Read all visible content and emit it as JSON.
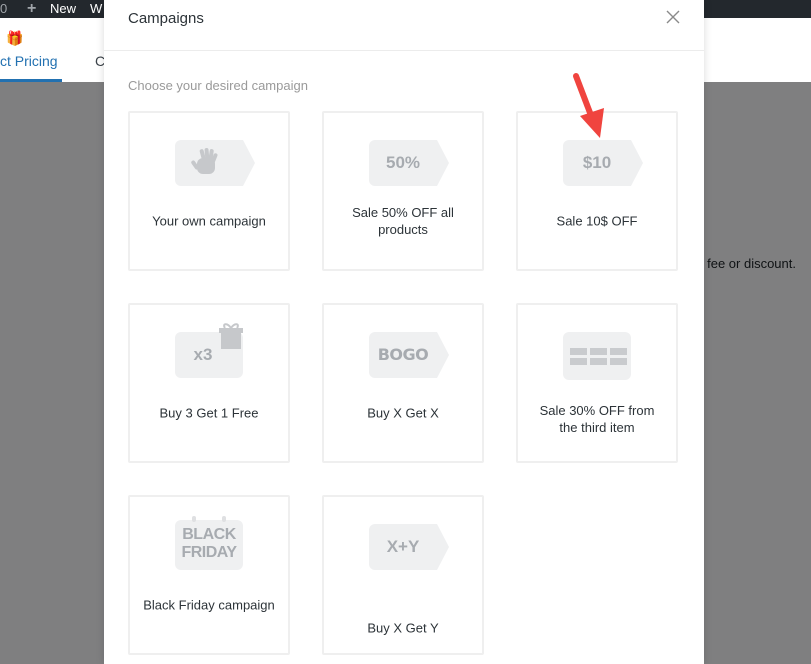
{
  "background": {
    "adminbar": {
      "counter": "0",
      "new_label": "New",
      "trailing": "W"
    },
    "tabs": [
      {
        "label": "ct Pricing",
        "icon": "gift-icon",
        "active": true
      },
      {
        "label": "C",
        "active": false
      }
    ],
    "body_text": "fee or discount.",
    "accent_color": "#2271b1"
  },
  "modal": {
    "title": "Campaigns",
    "close_icon": "close-icon",
    "subtitle": "Choose your desired campaign",
    "campaigns": [
      {
        "label": "Your own campaign",
        "icon": "hand-tag-icon",
        "icon_text": ""
      },
      {
        "label": "Sale 50% OFF all products",
        "icon": "percent-tag-icon",
        "icon_text": "50%"
      },
      {
        "label": "Sale 10$ OFF",
        "icon": "dollar-tag-icon",
        "icon_text": "$10"
      },
      {
        "label": "Buy 3 Get 1 Free",
        "icon": "gift-tag-icon",
        "icon_text": "x3"
      },
      {
        "label": "Buy X Get X",
        "icon": "bogo-tag-icon",
        "icon_text": "BOGO"
      },
      {
        "label": "Sale 30% OFF from the third item",
        "icon": "grid-items-icon",
        "icon_text": ""
      },
      {
        "label": "Black Friday campaign",
        "icon": "calendar-icon",
        "icon_text": "BLACK FRIDAY"
      },
      {
        "label": "Buy X Get Y",
        "icon": "xy-tag-icon",
        "icon_text": "X+Y"
      }
    ],
    "annotation_arrow_color": "#f0443f"
  }
}
